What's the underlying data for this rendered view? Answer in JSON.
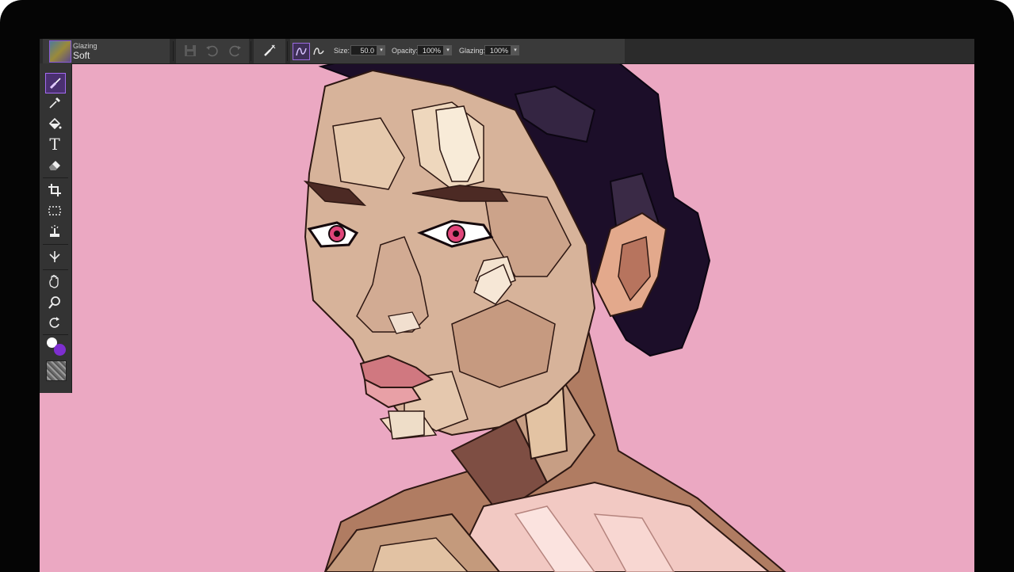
{
  "app": {
    "brush": {
      "category": "Glazing",
      "variant": "Soft"
    },
    "property_bar": {
      "size": {
        "label": "Size:",
        "value": "50.0"
      },
      "opacity": {
        "label": "Opacity:",
        "value": "100%"
      },
      "glazing": {
        "label": "Glazing:",
        "value": "100%"
      }
    },
    "icons": {
      "property_bar": [
        "save-icon",
        "undo-icon",
        "redo-icon",
        "brush-tracking-icon",
        "freehand-stroke-icon",
        "straight-line-icon"
      ],
      "toolbox": [
        "brush-tool-icon",
        "dropper-icon",
        "paint-bucket-icon",
        "text-icon",
        "eraser-icon",
        "crop-icon",
        "rect-selection-icon",
        "magic-wand-icon",
        "transform-icon",
        "grabber-icon",
        "magnifier-icon",
        "rotate-page-icon"
      ]
    },
    "colors": {
      "canvas_background": "#eba8c2",
      "main_color": "#7e2ed0",
      "additional_color": "#ffffff",
      "accent": "#a36af0"
    }
  }
}
